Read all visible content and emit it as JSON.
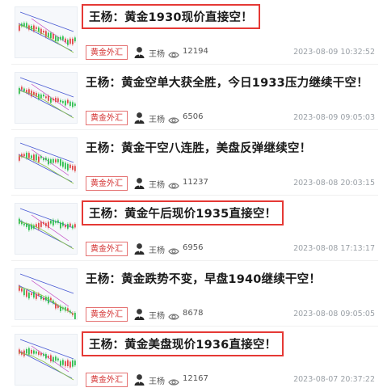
{
  "colors": {
    "accent_red": "#e53935",
    "tag_text": "#d32f2f"
  },
  "icons": {
    "views": "eye-icon",
    "author": "avatar"
  },
  "articles": [
    {
      "title": "王杨：黄金1930现价直接空！",
      "highlighted": true,
      "tag": "黄金外汇",
      "author": "王杨",
      "views": "12194",
      "time": "2023-08-09 10:32:52"
    },
    {
      "title": "王杨：黄金空单大获全胜，今日1933压力继续干空！",
      "highlighted": false,
      "tag": "黄金外汇",
      "author": "王杨",
      "views": "6506",
      "time": "2023-08-09 09:05:03"
    },
    {
      "title": "王杨：黄金干空八连胜，美盘反弹继续空！",
      "highlighted": false,
      "tag": "黄金外汇",
      "author": "王杨",
      "views": "11237",
      "time": "2023-08-08 20:03:15"
    },
    {
      "title": "王杨：黄金午后现价1935直接空！",
      "highlighted": true,
      "tag": "黄金外汇",
      "author": "王杨",
      "views": "6956",
      "time": "2023-08-08 17:13:17"
    },
    {
      "title": "王杨：黄金跌势不变，早盘1940继续干空！",
      "highlighted": false,
      "tag": "黄金外汇",
      "author": "王杨",
      "views": "8678",
      "time": "2023-08-08 09:05:05"
    },
    {
      "title": "王杨：黄金美盘现价1936直接空！",
      "highlighted": true,
      "tag": "黄金外汇",
      "author": "王杨",
      "views": "12167",
      "time": "2023-08-07 20:37:22"
    }
  ]
}
